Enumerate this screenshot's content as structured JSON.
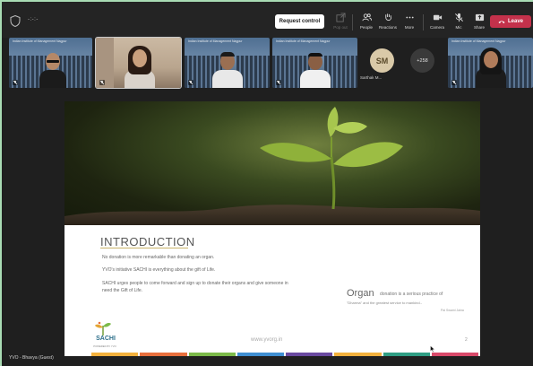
{
  "meeting": {
    "timer": "-:-:-",
    "request_control_label": "Request control",
    "toolbar": [
      {
        "label": "Pop out",
        "icon": "pop-out-icon",
        "dim": true
      },
      {
        "label": "People",
        "icon": "people-icon"
      },
      {
        "label": "Reactions",
        "icon": "reactions-icon"
      },
      {
        "label": "More",
        "icon": "more-icon"
      },
      {
        "label": "Camera",
        "icon": "camera-icon"
      },
      {
        "label": "Mic",
        "icon": "mic-icon"
      },
      {
        "label": "Share",
        "icon": "share-icon"
      }
    ],
    "leave_label": "Leave",
    "leave_color": "#c4314b"
  },
  "participants": {
    "tiles": [
      {
        "caption": "Indian Institute of Management Nagpur"
      },
      {
        "caption": ""
      },
      {
        "caption": "Indian Institute of Management Nagpur"
      },
      {
        "caption": "Indian Institute of Management Nagpur"
      },
      {
        "caption": "Indian Institute of Management Nagpur"
      }
    ],
    "avatar_initials": "SM",
    "avatar_name": "Sarthak M...",
    "more_count": "+258"
  },
  "slide": {
    "title": "INTRODUCTION",
    "paragraphs": [
      "No donation is more remarkable than donating an organ.",
      "YVO's initiative SACHI is everything about the gift of Life.",
      "SACHI urges people to come forward and sign up to donate their organs and give someone in need the Gift of Life."
    ],
    "quote_word": "Organ",
    "quote_rest": "donation is a serious practice of",
    "quote_line2": "\"Dharma\" and the greatest service to mankind.-",
    "quote_attr": "Pai Swami Jaina",
    "logo_name": "SACHI",
    "logo_sub": "POWERED BY YVO",
    "website": "www.yvorg.in",
    "page_number": "2",
    "accent_colors": [
      "#f4b13c",
      "#e86f3c",
      "#7cbb4a",
      "#3f8fd2",
      "#6a4aa0",
      "#f4b13c",
      "#2f9e84",
      "#d94a6a"
    ]
  },
  "presenter_label": "YVO - Bhavya (Guest)"
}
